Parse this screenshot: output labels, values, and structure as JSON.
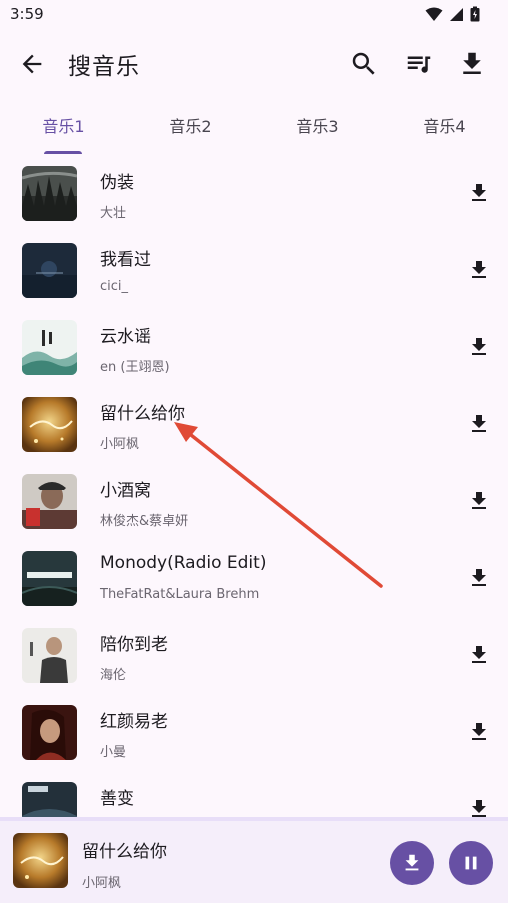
{
  "status": {
    "time": "3:59"
  },
  "appbar": {
    "title": "搜音乐"
  },
  "tabs": [
    {
      "label": "音乐1",
      "active": true
    },
    {
      "label": "音乐2",
      "active": false
    },
    {
      "label": "音乐3",
      "active": false
    },
    {
      "label": "音乐4",
      "active": false
    }
  ],
  "songs": [
    {
      "title": "伪装",
      "artist": "大壮"
    },
    {
      "title": "我看过",
      "artist": "cici_"
    },
    {
      "title": "云水谣",
      "artist": "en (王翊恩)"
    },
    {
      "title": "留什么给你",
      "artist": "小阿枫"
    },
    {
      "title": "小酒窝",
      "artist": "林俊杰&蔡卓妍"
    },
    {
      "title": "Monody(Radio Edit)",
      "artist": "TheFatRat&Laura Brehm"
    },
    {
      "title": "陪你到老",
      "artist": "海伦"
    },
    {
      "title": "红颜易老",
      "artist": "小曼"
    },
    {
      "title": "善变",
      "artist": ""
    }
  ],
  "player": {
    "title": "留什么给你",
    "artist": "小阿枫"
  },
  "colors": {
    "accent": "#6750a4",
    "background": "#fdf7fd",
    "arrow": "#e04a36"
  }
}
